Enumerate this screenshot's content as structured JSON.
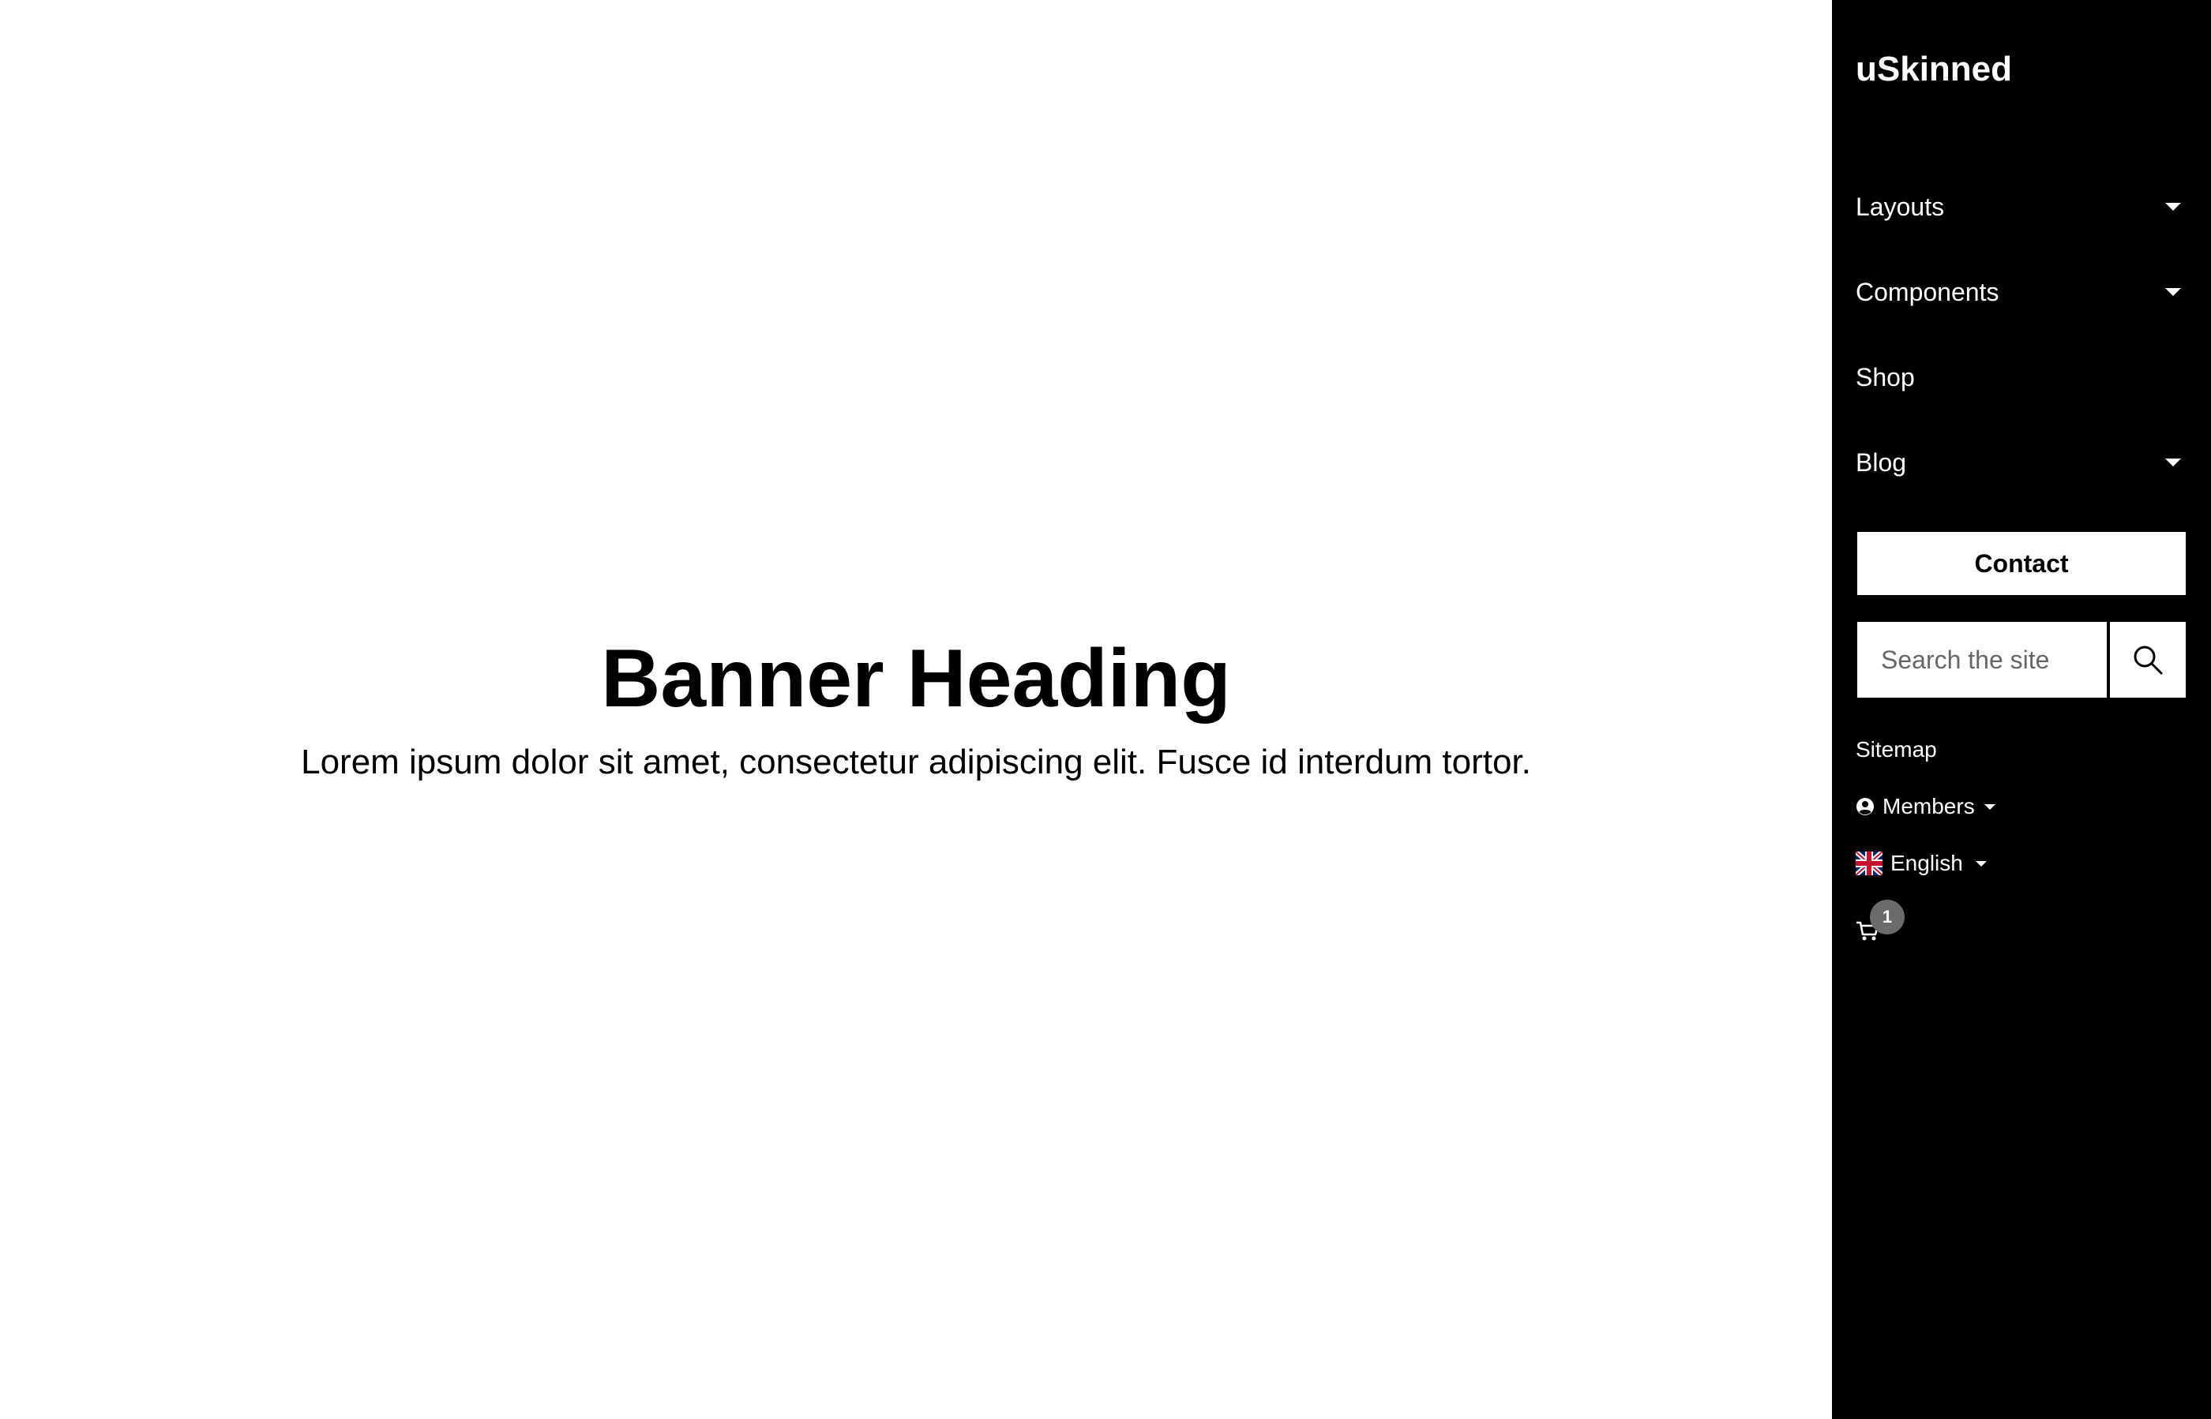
{
  "banner": {
    "heading": "Banner Heading",
    "text": "Lorem ipsum dolor sit amet, consectetur adipiscing elit. Fusce id interdum tortor."
  },
  "sidebar": {
    "logo": "uSkinned",
    "nav": [
      {
        "label": "Layouts",
        "has_dropdown": true
      },
      {
        "label": "Components",
        "has_dropdown": true
      },
      {
        "label": "Shop",
        "has_dropdown": false
      },
      {
        "label": "Blog",
        "has_dropdown": true
      }
    ],
    "contact_label": "Contact",
    "search": {
      "placeholder": "Search the site",
      "icon": "search-icon"
    },
    "sitemap_label": "Sitemap",
    "members_label": "Members",
    "language_label": "English",
    "cart_count": "1"
  },
  "colors": {
    "sidebar_bg": "#000000",
    "main_bg": "#ffffff",
    "badge_bg": "#6b6b6b"
  }
}
